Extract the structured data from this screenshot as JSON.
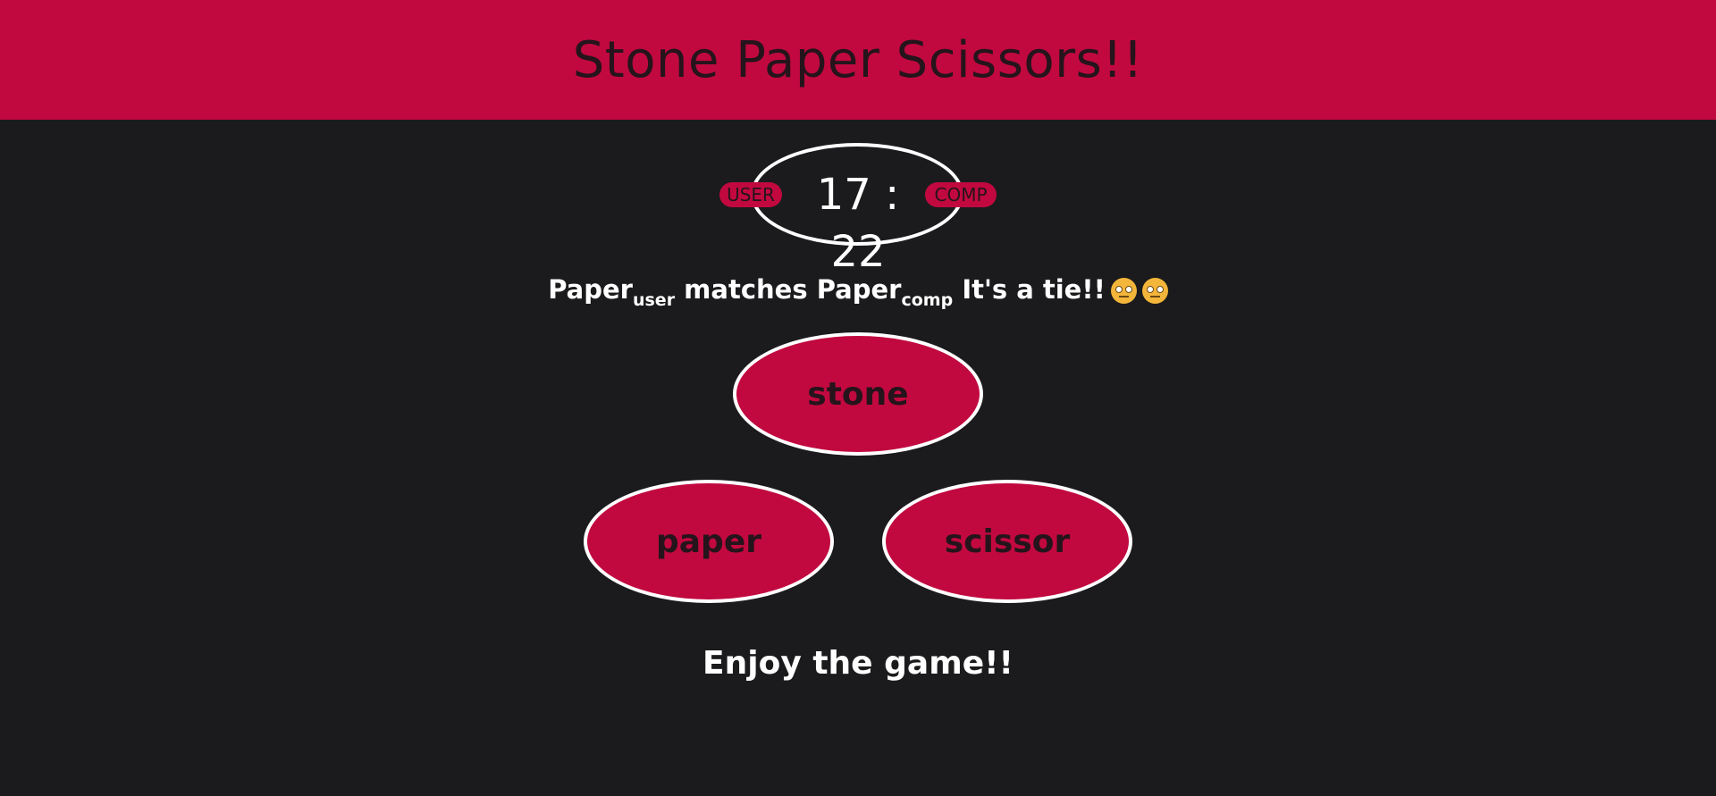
{
  "header": {
    "title": "Stone Paper Scissors!!"
  },
  "scoreboard": {
    "user_label": "USER",
    "comp_label": "COMP",
    "score_text": "17 : 22",
    "user_score": 17,
    "comp_score": 22
  },
  "result": {
    "user_choice": "Paper",
    "user_sub": "user",
    "verb": "matches",
    "comp_choice": "Paper",
    "comp_sub": "comp",
    "outcome": "It's a tie!!",
    "emoji_icon": "neutral-face-icon"
  },
  "choices": {
    "stone": "stone",
    "paper": "paper",
    "scissor": "scissor"
  },
  "footer": {
    "message": "Enjoy the game!!"
  },
  "colors": {
    "accent": "#c1093f",
    "background": "#1b1b1d",
    "text": "#ffffff",
    "dark_text": "#25141b"
  }
}
